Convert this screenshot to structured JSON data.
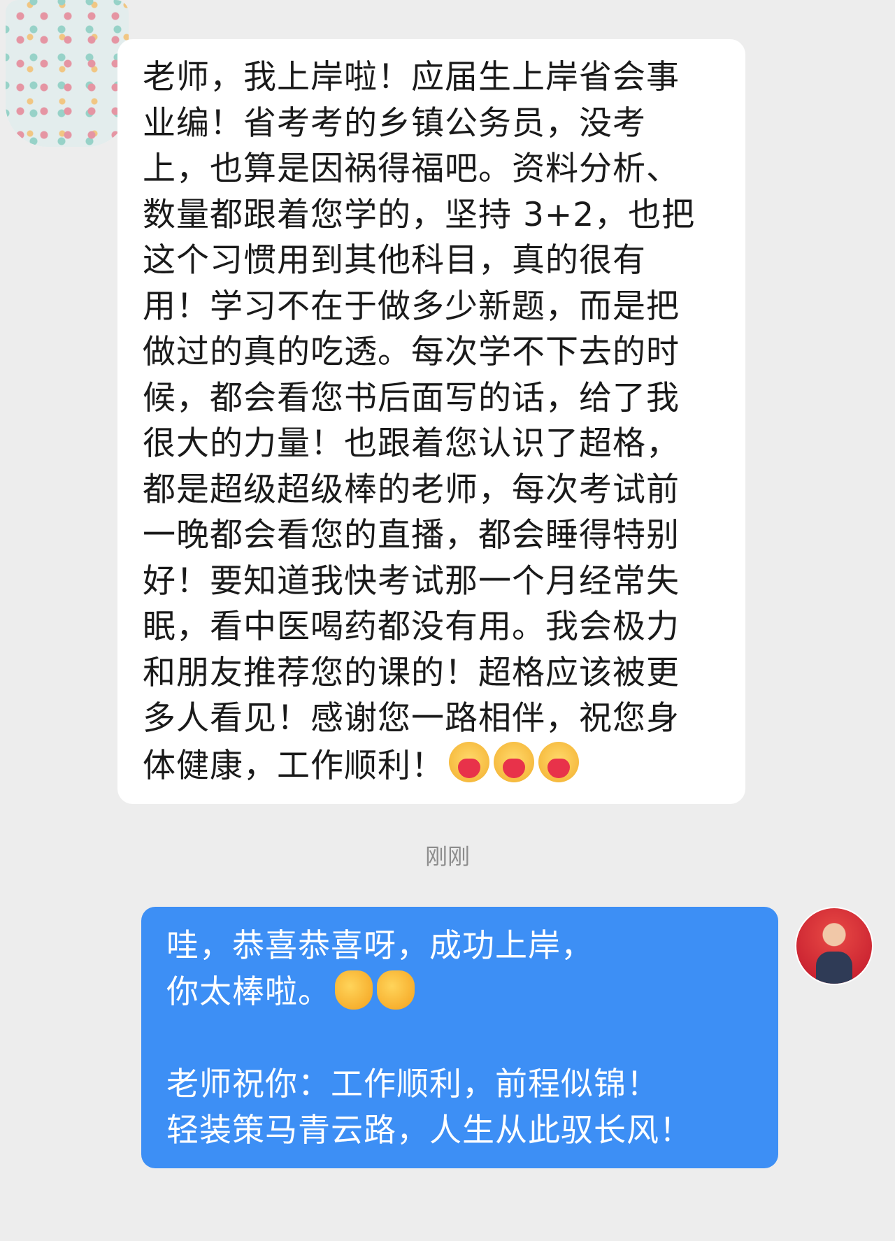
{
  "incoming_message": {
    "lines": [
      "老师，我上岸啦！应届生上岸省会事",
      "业编！省考考的乡镇公务员，没考",
      "上，也算是因祸得福吧。资料分析、",
      "数量都跟着您学的，坚持 3+2，也把",
      "这个习惯用到其他科目，真的很有",
      "用！学习不在于做多少新题，而是把",
      "做过的真的吃透。每次学不下去的时",
      "候，都会看您书后面写的话，给了我",
      "很大的力量！也跟着您认识了超格，",
      "都是超级超级棒的老师，每次考试前",
      "一晚都会看您的直播，都会睡得特别",
      "好！要知道我快考试那一个月经常失",
      "眠，看中医喝药都没有用。我会极力",
      "和朋友推荐您的课的！超格应该被更",
      "多人看见！感谢您一路相伴，祝您身",
      "体健康，工作顺利！"
    ],
    "trailing_emojis": [
      "heart-face-emoji",
      "heart-face-emoji",
      "heart-face-emoji"
    ]
  },
  "timestamp": "刚刚",
  "outgoing_message": {
    "lines": [
      "哇，恭喜恭喜呀，成功上岸，",
      "你太棒啦。",
      "",
      "老师祝你：工作顺利，前程似锦！",
      "轻装策马青云路，人生从此驭长风！"
    ],
    "trailing_emojis": [
      "clapping-hands-emoji",
      "clapping-hands-emoji"
    ]
  },
  "colors": {
    "background": "#ededed",
    "incoming_bubble": "#ffffff",
    "outgoing_bubble": "#3d8ff5",
    "timestamp_text": "#8c8c8c"
  }
}
